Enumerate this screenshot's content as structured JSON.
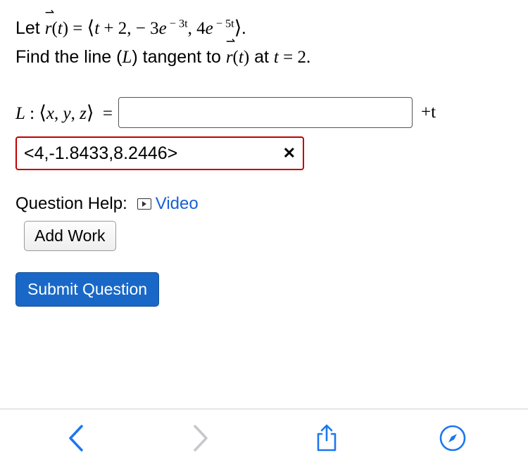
{
  "problem": {
    "let": "Let ",
    "r_of_t": "r⃗(t)",
    "equals": " = ",
    "langle": "⟨",
    "comp1": "t + 2, ",
    "comp2a": " − 3e",
    "comp2exp": " − 3t",
    "comp2b": ", 4e",
    "comp3exp": " − 5t",
    "rangle": "⟩",
    "period": ".",
    "find": "Find the line (L) tangent to ",
    "r_of_t2": "r⃗(t)",
    "at": " at t = 2."
  },
  "answer": {
    "L": "L : ",
    "xyz_l": "⟨",
    "xyz": "x, y, z",
    "xyz_r": "⟩",
    "eq": " = ",
    "plus_t": "+t",
    "input1": "",
    "input2": "<4,-1.8433,8.2446>",
    "xmark": "✕"
  },
  "help": {
    "label": "Question Help:",
    "video": "Video",
    "addwork": "Add Work"
  },
  "submit": "Submit Question"
}
